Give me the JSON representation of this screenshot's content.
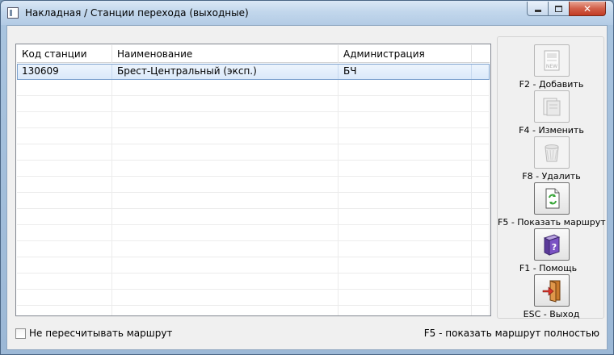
{
  "window": {
    "title": "Накладная / Станции перехода (выходные)"
  },
  "titlebar_buttons": {
    "minimize_icon": "minimize-icon",
    "maximize_icon": "maximize-icon",
    "close_icon": "close-icon",
    "close_glyph": "✕"
  },
  "table": {
    "columns": [
      "Код станции",
      "Наименование",
      "Администрация"
    ],
    "rows": [
      {
        "code": "130609",
        "name": "Брест-Центральный (эксп.)",
        "admin": "БЧ",
        "selected": true
      }
    ]
  },
  "actions": [
    {
      "label": "F2 - Добавить",
      "icon": "new-document-icon",
      "enabled": false
    },
    {
      "label": "F4 - Изменить",
      "icon": "edit-document-icon",
      "enabled": false
    },
    {
      "label": "F8 - Удалить",
      "icon": "wastebasket-icon",
      "enabled": false
    },
    {
      "label": "F5 - Показать маршрут",
      "icon": "route-refresh-icon",
      "enabled": true
    },
    {
      "label": "F1 - Помощь",
      "icon": "help-book-icon",
      "enabled": true
    },
    {
      "label": "ESC - Выход",
      "icon": "exit-door-icon",
      "enabled": true
    }
  ],
  "footer": {
    "checkbox_label": "Не пересчитывать маршрут",
    "checkbox_checked": false,
    "hint": "F5 - показать маршрут полностью"
  },
  "colors": {
    "selection_border": "#7da2ce",
    "close_button": "#c23c24",
    "window_frame": "#a9c4df"
  }
}
